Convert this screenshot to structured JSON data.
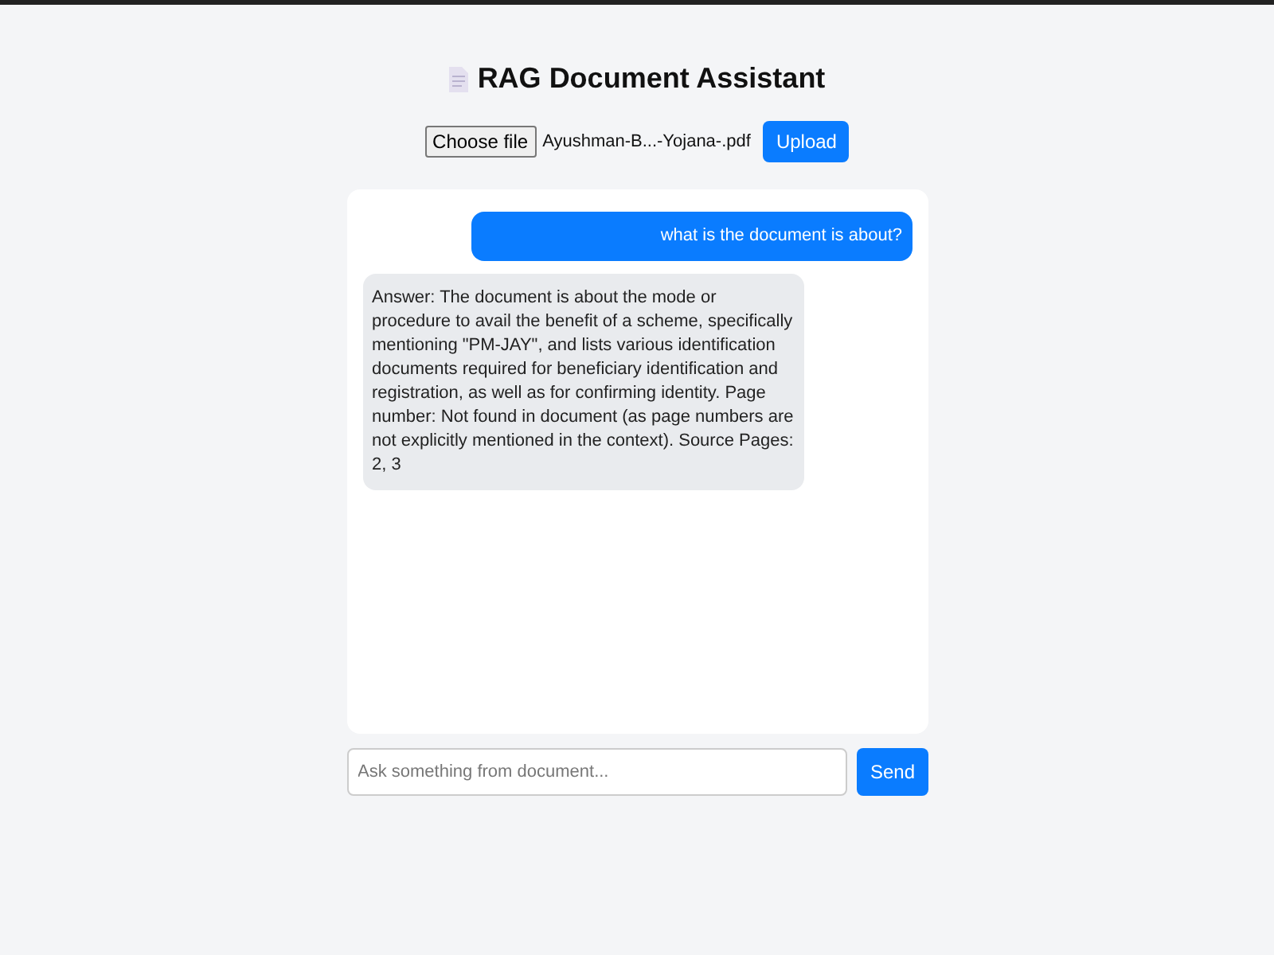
{
  "title": "RAG Document Assistant",
  "upload": {
    "choose_label": "Choose file",
    "file_name": "Ayushman-B...-Yojana-.pdf",
    "button": "Upload"
  },
  "messages": [
    {
      "kind": "user",
      "text": "what is the document is about?"
    },
    {
      "kind": "assistant",
      "text": "Answer: The document is about the mode or procedure to avail the benefit of a scheme, specifically mentioning \"PM-JAY\", and lists various identification documents required for beneficiary identification and registration, as well as for confirming identity. Page number: Not found in document (as page numbers are not explicitly mentioned in the context). Source Pages: 2, 3"
    }
  ],
  "composer": {
    "placeholder": "Ask something from document...",
    "button": "Send"
  }
}
